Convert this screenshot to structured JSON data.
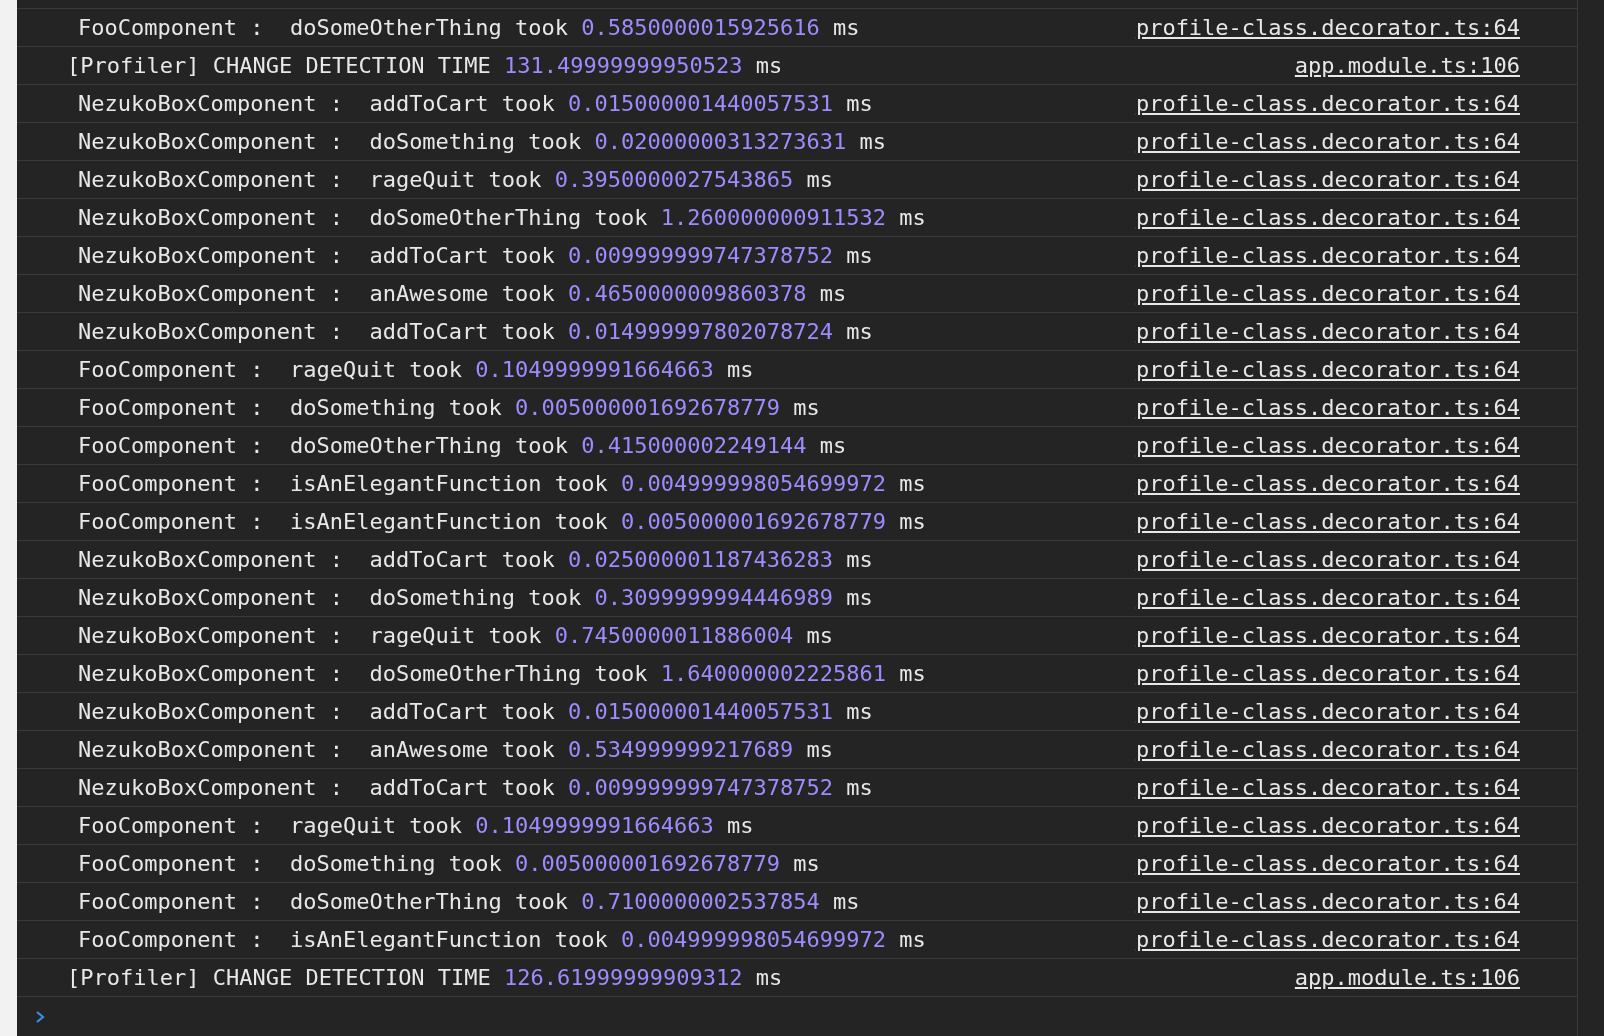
{
  "console": {
    "messages": [
      {
        "kind": "method",
        "text": "FooComponent :  doSomeOtherThing took",
        "value": "0.5850000015925616",
        "unit": "ms",
        "source": "profile-class.decorator.ts:64"
      },
      {
        "kind": "profiler",
        "text": "[Profiler] CHANGE DETECTION TIME",
        "value": "131.49999999950523",
        "unit": "ms",
        "source": "app.module.ts:106"
      },
      {
        "kind": "method",
        "text": "NezukoBoxComponent :  addToCart took",
        "value": "0.015000001440057531",
        "unit": "ms",
        "source": "profile-class.decorator.ts:64"
      },
      {
        "kind": "method",
        "text": "NezukoBoxComponent :  doSomething took",
        "value": "0.02000000313273631",
        "unit": "ms",
        "source": "profile-class.decorator.ts:64"
      },
      {
        "kind": "method",
        "text": "NezukoBoxComponent :  rageQuit took",
        "value": "0.3950000027543865",
        "unit": "ms",
        "source": "profile-class.decorator.ts:64"
      },
      {
        "kind": "method",
        "text": "NezukoBoxComponent :  doSomeOtherThing took",
        "value": "1.260000000911532",
        "unit": "ms",
        "source": "profile-class.decorator.ts:64"
      },
      {
        "kind": "method",
        "text": "NezukoBoxComponent :  addToCart took",
        "value": "0.009999999747378752",
        "unit": "ms",
        "source": "profile-class.decorator.ts:64"
      },
      {
        "kind": "method",
        "text": "NezukoBoxComponent :  anAwesome took",
        "value": "0.4650000009860378",
        "unit": "ms",
        "source": "profile-class.decorator.ts:64"
      },
      {
        "kind": "method",
        "text": "NezukoBoxComponent :  addToCart took",
        "value": "0.014999997802078724",
        "unit": "ms",
        "source": "profile-class.decorator.ts:64"
      },
      {
        "kind": "method",
        "text": "FooComponent :  rageQuit took",
        "value": "0.1049999991664663",
        "unit": "ms",
        "source": "profile-class.decorator.ts:64"
      },
      {
        "kind": "method",
        "text": "FooComponent :  doSomething took",
        "value": "0.005000001692678779",
        "unit": "ms",
        "source": "profile-class.decorator.ts:64"
      },
      {
        "kind": "method",
        "text": "FooComponent :  doSomeOtherThing took",
        "value": "0.415000002249144",
        "unit": "ms",
        "source": "profile-class.decorator.ts:64"
      },
      {
        "kind": "method",
        "text": "FooComponent :  isAnElegantFunction took",
        "value": "0.004999998054699972",
        "unit": "ms",
        "source": "profile-class.decorator.ts:64"
      },
      {
        "kind": "method",
        "text": "FooComponent :  isAnElegantFunction took",
        "value": "0.005000001692678779",
        "unit": "ms",
        "source": "profile-class.decorator.ts:64"
      },
      {
        "kind": "method",
        "text": "NezukoBoxComponent :  addToCart took",
        "value": "0.025000001187436283",
        "unit": "ms",
        "source": "profile-class.decorator.ts:64"
      },
      {
        "kind": "method",
        "text": "NezukoBoxComponent :  doSomething took",
        "value": "0.3099999994446989",
        "unit": "ms",
        "source": "profile-class.decorator.ts:64"
      },
      {
        "kind": "method",
        "text": "NezukoBoxComponent :  rageQuit took",
        "value": "0.7450000011886004",
        "unit": "ms",
        "source": "profile-class.decorator.ts:64"
      },
      {
        "kind": "method",
        "text": "NezukoBoxComponent :  doSomeOtherThing took",
        "value": "1.640000002225861",
        "unit": "ms",
        "source": "profile-class.decorator.ts:64"
      },
      {
        "kind": "method",
        "text": "NezukoBoxComponent :  addToCart took",
        "value": "0.015000001440057531",
        "unit": "ms",
        "source": "profile-class.decorator.ts:64"
      },
      {
        "kind": "method",
        "text": "NezukoBoxComponent :  anAwesome took",
        "value": "0.534999999217689",
        "unit": "ms",
        "source": "profile-class.decorator.ts:64"
      },
      {
        "kind": "method",
        "text": "NezukoBoxComponent :  addToCart took",
        "value": "0.009999999747378752",
        "unit": "ms",
        "source": "profile-class.decorator.ts:64"
      },
      {
        "kind": "method",
        "text": "FooComponent :  rageQuit took",
        "value": "0.1049999991664663",
        "unit": "ms",
        "source": "profile-class.decorator.ts:64"
      },
      {
        "kind": "method",
        "text": "FooComponent :  doSomething took",
        "value": "0.005000001692678779",
        "unit": "ms",
        "source": "profile-class.decorator.ts:64"
      },
      {
        "kind": "method",
        "text": "FooComponent :  doSomeOtherThing took",
        "value": "0.7100000002537854",
        "unit": "ms",
        "source": "profile-class.decorator.ts:64"
      },
      {
        "kind": "method",
        "text": "FooComponent :  isAnElegantFunction took",
        "value": "0.004999998054699972",
        "unit": "ms",
        "source": "profile-class.decorator.ts:64"
      },
      {
        "kind": "profiler",
        "text": "[Profiler] CHANGE DETECTION TIME",
        "value": "126.61999999909312",
        "unit": "ms",
        "source": "app.module.ts:106"
      }
    ]
  }
}
